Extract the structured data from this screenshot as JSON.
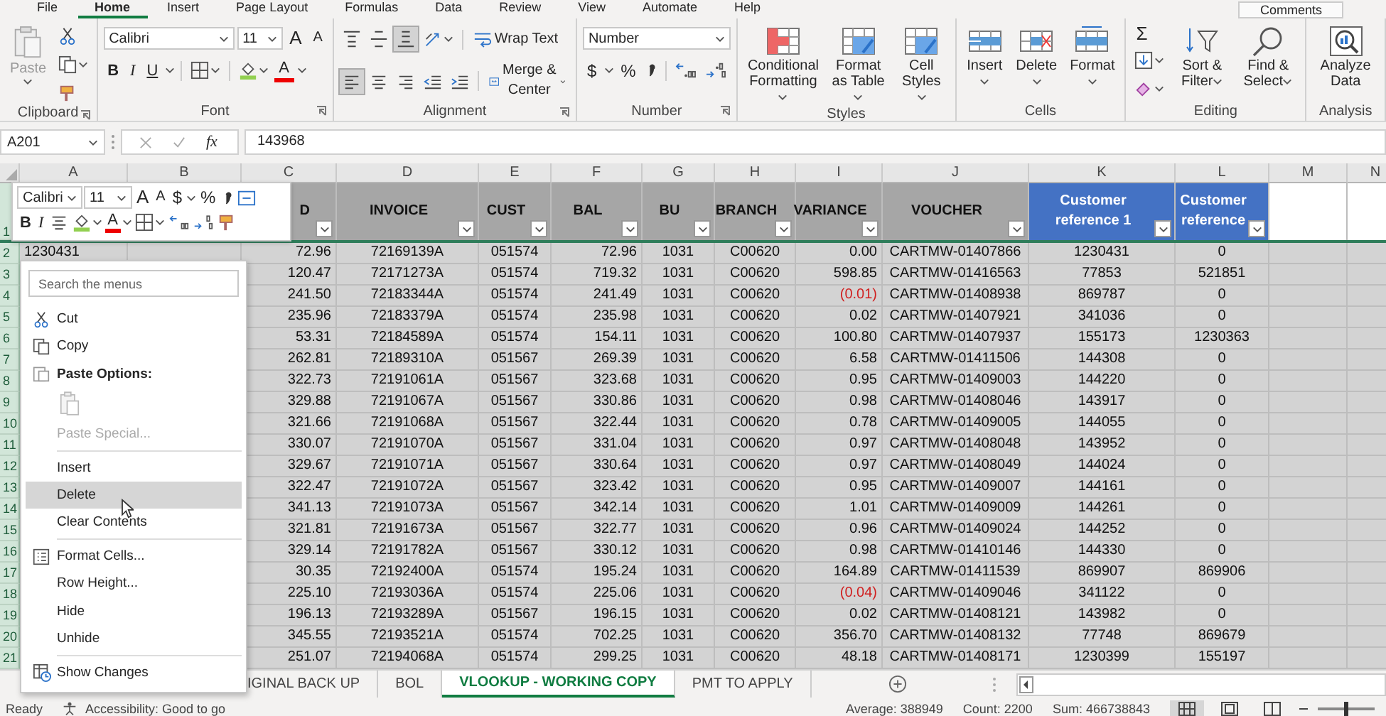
{
  "ribbon_tabs": [
    {
      "label": "File",
      "selected": false
    },
    {
      "label": "Home",
      "selected": true
    },
    {
      "label": "Insert",
      "selected": false
    },
    {
      "label": "Page Layout",
      "selected": false
    },
    {
      "label": "Formulas",
      "selected": false
    },
    {
      "label": "Data",
      "selected": false
    },
    {
      "label": "Review",
      "selected": false
    },
    {
      "label": "View",
      "selected": false
    },
    {
      "label": "Automate",
      "selected": false
    },
    {
      "label": "Help",
      "selected": false
    }
  ],
  "comments_button": "Comments",
  "ribbon": {
    "groups": [
      {
        "kind": "clipboard",
        "label": "Clipboard",
        "paste": "Paste"
      },
      {
        "kind": "font",
        "label": "Font",
        "font": "Calibri",
        "size": "11",
        "grow": "A",
        "shrink": "A",
        "bold": "B",
        "italic": "I",
        "underline": "U",
        "font_color": "A"
      },
      {
        "kind": "alignment",
        "label": "Alignment",
        "vertical_align": [
          {
            "selected": false
          },
          {
            "selected": false
          },
          {
            "selected": true
          }
        ],
        "horizontal_align": [
          {
            "selected": true
          },
          {
            "selected": false
          },
          {
            "selected": false
          }
        ],
        "wrap": "Wrap Text",
        "merge": "Merge & Center"
      },
      {
        "kind": "number",
        "label": "Number",
        "format": "Number",
        "currency": "$",
        "percent": "%"
      },
      {
        "kind": "styles",
        "label": "Styles",
        "buttons": [
          "Conditional Formatting",
          "Format as Table",
          "Cell Styles"
        ]
      },
      {
        "kind": "cells",
        "label": "Cells",
        "buttons": [
          "Insert",
          "Delete",
          "Format"
        ]
      },
      {
        "kind": "editing",
        "label": "Editing",
        "autosum": "Σ",
        "buttons": [
          "Sort & Filter",
          "Find & Select"
        ]
      },
      {
        "kind": "analysis",
        "label": "Analysis",
        "buttons": [
          "Analyze Data"
        ]
      }
    ]
  },
  "formula_bar": {
    "name_box": "A201",
    "function_label": "fx",
    "value": "143968"
  },
  "sheet": {
    "column_letters": [
      "A",
      "B",
      "C",
      "D",
      "E",
      "F",
      "G",
      "H",
      "I",
      "J",
      "K",
      "L",
      "M",
      "N"
    ],
    "row_numbers": [
      "1",
      "2",
      "3",
      "4",
      "5",
      "6",
      "7",
      "8",
      "9",
      "10",
      "11",
      "12",
      "13",
      "14",
      "15",
      "16",
      "17",
      "18",
      "19",
      "20",
      "21"
    ],
    "headers": [
      {
        "label": "D",
        "kind": "plain"
      },
      {
        "label": "INVOICE",
        "kind": "plain"
      },
      {
        "label": "CUST",
        "kind": "plain"
      },
      {
        "label": "BAL",
        "kind": "plain"
      },
      {
        "label": "BU",
        "kind": "plain"
      },
      {
        "label": "BRANCH",
        "kind": "plain"
      },
      {
        "label": "VARIANCE",
        "kind": "plain"
      },
      {
        "label": "VOUCHER",
        "kind": "plain"
      },
      {
        "label": "Customer reference 1",
        "kind": "highlighted"
      },
      {
        "label": "Customer reference",
        "kind": "highlighted"
      }
    ],
    "rows": [
      {
        "col_a": "1230431",
        "col_c": "72.96",
        "invoice": "72169139A",
        "cust": "051574",
        "bal": "72.96",
        "bu": "1031",
        "branch": "C00620",
        "variance": "0.00",
        "variance_negative": false,
        "voucher": "CARTMW-01407866",
        "ref1": "1230431",
        "ref2": "0"
      },
      {
        "col_c": "120.47",
        "invoice": "72171273A",
        "cust": "051574",
        "bal": "719.32",
        "bu": "1031",
        "branch": "C00620",
        "variance": "598.85",
        "variance_negative": false,
        "voucher": "CARTMW-01416563",
        "ref1": "77853",
        "ref2": "521851"
      },
      {
        "col_c": "241.50",
        "invoice": "72183344A",
        "cust": "051574",
        "bal": "241.49",
        "bu": "1031",
        "branch": "C00620",
        "variance": "(0.01)",
        "variance_negative": true,
        "voucher": "CARTMW-01408938",
        "ref1": "869787",
        "ref2": "0"
      },
      {
        "col_c": "235.96",
        "invoice": "72183379A",
        "cust": "051574",
        "bal": "235.98",
        "bu": "1031",
        "branch": "C00620",
        "variance": "0.02",
        "variance_negative": false,
        "voucher": "CARTMW-01407921",
        "ref1": "341036",
        "ref2": "0"
      },
      {
        "col_c": "53.31",
        "invoice": "72184589A",
        "cust": "051574",
        "bal": "154.11",
        "bu": "1031",
        "branch": "C00620",
        "variance": "100.80",
        "variance_negative": false,
        "voucher": "CARTMW-01407937",
        "ref1": "155173",
        "ref2": "1230363"
      },
      {
        "col_c": "262.81",
        "invoice": "72189310A",
        "cust": "051567",
        "bal": "269.39",
        "bu": "1031",
        "branch": "C00620",
        "variance": "6.58",
        "variance_negative": false,
        "voucher": "CARTMW-01411506",
        "ref1": "144308",
        "ref2": "0"
      },
      {
        "col_c": "322.73",
        "invoice": "72191061A",
        "cust": "051567",
        "bal": "323.68",
        "bu": "1031",
        "branch": "C00620",
        "variance": "0.95",
        "variance_negative": false,
        "voucher": "CARTMW-01409003",
        "ref1": "144220",
        "ref2": "0"
      },
      {
        "col_c": "329.88",
        "invoice": "72191067A",
        "cust": "051567",
        "bal": "330.86",
        "bu": "1031",
        "branch": "C00620",
        "variance": "0.98",
        "variance_negative": false,
        "voucher": "CARTMW-01408046",
        "ref1": "143917",
        "ref2": "0"
      },
      {
        "col_c": "321.66",
        "invoice": "72191068A",
        "cust": "051567",
        "bal": "322.44",
        "bu": "1031",
        "branch": "C00620",
        "variance": "0.78",
        "variance_negative": false,
        "voucher": "CARTMW-01409005",
        "ref1": "144055",
        "ref2": "0"
      },
      {
        "col_c": "330.07",
        "invoice": "72191070A",
        "cust": "051567",
        "bal": "331.04",
        "bu": "1031",
        "branch": "C00620",
        "variance": "0.97",
        "variance_negative": false,
        "voucher": "CARTMW-01408048",
        "ref1": "143952",
        "ref2": "0"
      },
      {
        "col_c": "329.67",
        "invoice": "72191071A",
        "cust": "051567",
        "bal": "330.64",
        "bu": "1031",
        "branch": "C00620",
        "variance": "0.97",
        "variance_negative": false,
        "voucher": "CARTMW-01408049",
        "ref1": "144024",
        "ref2": "0"
      },
      {
        "col_c": "322.47",
        "invoice": "72191072A",
        "cust": "051567",
        "bal": "323.42",
        "bu": "1031",
        "branch": "C00620",
        "variance": "0.95",
        "variance_negative": false,
        "voucher": "CARTMW-01409007",
        "ref1": "144161",
        "ref2": "0"
      },
      {
        "col_c": "341.13",
        "invoice": "72191073A",
        "cust": "051567",
        "bal": "342.14",
        "bu": "1031",
        "branch": "C00620",
        "variance": "1.01",
        "variance_negative": false,
        "voucher": "CARTMW-01409009",
        "ref1": "144261",
        "ref2": "0"
      },
      {
        "col_c": "321.81",
        "invoice": "72191673A",
        "cust": "051567",
        "bal": "322.77",
        "bu": "1031",
        "branch": "C00620",
        "variance": "0.96",
        "variance_negative": false,
        "voucher": "CARTMW-01409024",
        "ref1": "144252",
        "ref2": "0"
      },
      {
        "col_c": "329.14",
        "invoice": "72191782A",
        "cust": "051567",
        "bal": "330.12",
        "bu": "1031",
        "branch": "C00620",
        "variance": "0.98",
        "variance_negative": false,
        "voucher": "CARTMW-01410146",
        "ref1": "144330",
        "ref2": "0"
      },
      {
        "col_c": "30.35",
        "invoice": "72192400A",
        "cust": "051574",
        "bal": "195.24",
        "bu": "1031",
        "branch": "C00620",
        "variance": "164.89",
        "variance_negative": false,
        "voucher": "CARTMW-01411539",
        "ref1": "869907",
        "ref2": "869906"
      },
      {
        "col_c": "225.10",
        "invoice": "72193036A",
        "cust": "051574",
        "bal": "225.06",
        "bu": "1031",
        "branch": "C00620",
        "variance": "(0.04)",
        "variance_negative": true,
        "voucher": "CARTMW-01409046",
        "ref1": "341122",
        "ref2": "0"
      },
      {
        "col_c": "196.13",
        "invoice": "72193289A",
        "cust": "051567",
        "bal": "196.15",
        "bu": "1031",
        "branch": "C00620",
        "variance": "0.02",
        "variance_negative": false,
        "voucher": "CARTMW-01408121",
        "ref1": "143982",
        "ref2": "0"
      },
      {
        "col_c": "345.55",
        "invoice": "72193521A",
        "cust": "051574",
        "bal": "702.25",
        "bu": "1031",
        "branch": "C00620",
        "variance": "356.70",
        "variance_negative": false,
        "voucher": "CARTMW-01408132",
        "ref1": "77748",
        "ref2": "869679"
      },
      {
        "col_c": "251.07",
        "invoice": "72194068A",
        "cust": "051574",
        "bal": "299.25",
        "bu": "1031",
        "branch": "C00620",
        "variance": "48.18",
        "variance_negative": false,
        "voucher": "CARTMW-01408171",
        "ref1": "1230399",
        "ref2": "155197"
      }
    ]
  },
  "mini_toolbar": {
    "font": "Calibri",
    "size": "11",
    "grow": "A",
    "shrink": "A",
    "currency": "$",
    "percent": "%",
    "bold": "B",
    "italic": "I",
    "font_color": "A"
  },
  "context_menu": {
    "search_placeholder": "Search the menus",
    "items": [
      {
        "kind": "cut",
        "label": "Cut",
        "disabled": false,
        "selected": false
      },
      {
        "kind": "copy",
        "label": "Copy",
        "disabled": false,
        "selected": false
      },
      {
        "kind": "paste",
        "label": "Paste Options:",
        "disabled": false,
        "selected": false
      },
      {
        "kind": "pasteicon",
        "disabled": true,
        "selected": false
      },
      {
        "kind": "plain",
        "label": "Paste Special...",
        "disabled": true,
        "selected": false
      },
      {
        "kind": "separator"
      },
      {
        "kind": "plain",
        "label": "Insert",
        "disabled": false,
        "selected": false
      },
      {
        "kind": "plain",
        "label": "Delete",
        "disabled": false,
        "selected": true
      },
      {
        "kind": "plain",
        "label": "Clear Contents",
        "disabled": false,
        "selected": false
      },
      {
        "kind": "separator"
      },
      {
        "kind": "format",
        "label": "Format Cells...",
        "disabled": false,
        "selected": false
      },
      {
        "kind": "plain",
        "label": "Row Height...",
        "disabled": false,
        "selected": false
      },
      {
        "kind": "plain",
        "label": "Hide",
        "disabled": false,
        "selected": false
      },
      {
        "kind": "plain",
        "label": "Unhide",
        "disabled": false,
        "selected": false
      },
      {
        "kind": "separator"
      },
      {
        "kind": "changes",
        "label": "Show Changes",
        "disabled": false,
        "selected": false
      }
    ]
  },
  "sheet_tabs": [
    {
      "label": "IGINAL BACK UP",
      "selected": false
    },
    {
      "label": "BOL",
      "selected": false
    },
    {
      "label": "VLOOKUP - WORKING COPY",
      "selected": true
    },
    {
      "label": "PMT TO APPLY",
      "selected": false
    }
  ],
  "status_bar": {
    "mode": "Ready",
    "accessibility": "Accessibility: Good to go",
    "average": "Average: 388949",
    "count": "Count: 2200",
    "sum": "Sum: 466738843",
    "zoom": {
      "level": 0.5
    }
  }
}
